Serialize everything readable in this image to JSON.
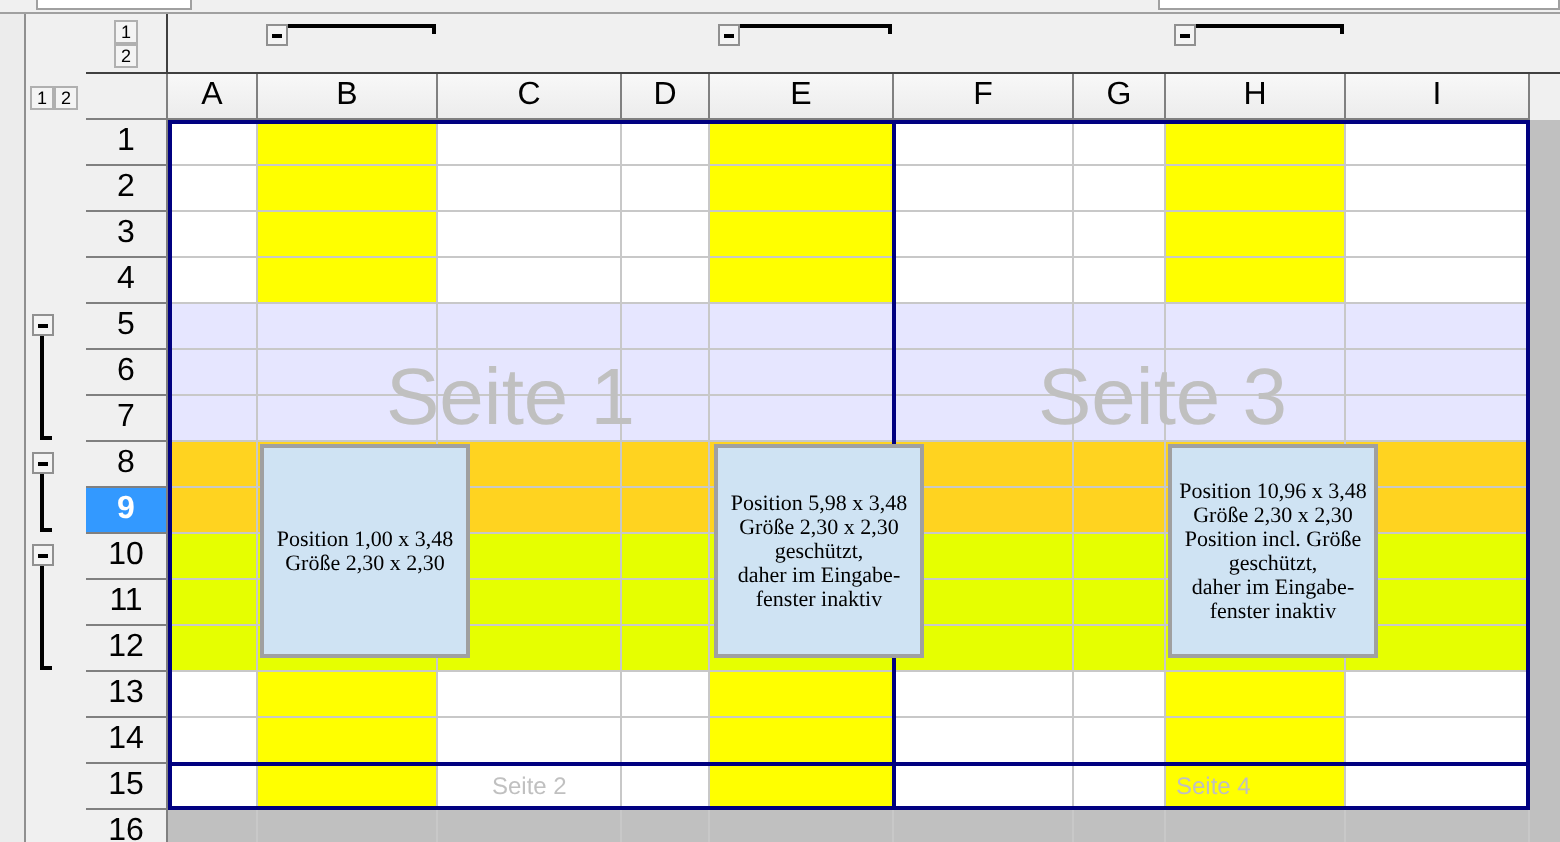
{
  "column_outline_levels": [
    "1",
    "2"
  ],
  "row_outline_levels": [
    "1",
    "2"
  ],
  "columns": [
    {
      "label": "A",
      "selected": false
    },
    {
      "label": "B",
      "selected": false,
      "color": "#ffff00",
      "grouped": true,
      "expanded": true
    },
    {
      "label": "C",
      "selected": false
    },
    {
      "label": "D",
      "selected": false
    },
    {
      "label": "E",
      "selected": false,
      "color": "#ffff00",
      "grouped": true,
      "expanded": true
    },
    {
      "label": "F",
      "selected": false
    },
    {
      "label": "G",
      "selected": false
    },
    {
      "label": "H",
      "selected": false,
      "color": "#ffff00",
      "grouped": true,
      "expanded": true
    },
    {
      "label": "I",
      "selected": false
    }
  ],
  "rows": [
    {
      "label": "1",
      "selected": false
    },
    {
      "label": "2",
      "selected": false
    },
    {
      "label": "3",
      "selected": false
    },
    {
      "label": "4",
      "selected": false
    },
    {
      "label": "5",
      "selected": false,
      "color": "#e6e6ff",
      "group_start": true,
      "expanded": true
    },
    {
      "label": "6",
      "selected": false,
      "color": "#e6e6ff",
      "in_group": true
    },
    {
      "label": "7",
      "selected": false,
      "color": "#e6e6ff",
      "in_group": true
    },
    {
      "label": "8",
      "selected": false,
      "color": "#ffd320",
      "group_start": true,
      "expanded": true
    },
    {
      "label": "9",
      "selected": true,
      "color": "#ffd320",
      "in_group": true
    },
    {
      "label": "10",
      "selected": false,
      "color": "#e6ff00",
      "group_start": true,
      "expanded": true
    },
    {
      "label": "11",
      "selected": false,
      "color": "#e6ff00",
      "in_group": true
    },
    {
      "label": "12",
      "selected": false,
      "color": "#e6ff00",
      "in_group": true
    },
    {
      "label": "13",
      "selected": false
    },
    {
      "label": "14",
      "selected": false
    },
    {
      "label": "15",
      "selected": false
    },
    {
      "label": "16",
      "selected": false,
      "color": "#c0c0c0"
    }
  ],
  "page_labels": [
    {
      "text": "Seite 1",
      "kind": "large"
    },
    {
      "text": "Seite 3",
      "kind": "large"
    },
    {
      "text": "Seite 2",
      "kind": "small"
    },
    {
      "text": "Seite 4",
      "kind": "small"
    }
  ],
  "text_boxes": [
    {
      "text": "Position 1,00 x 3,48\nGröße 2,30 x 2,30"
    },
    {
      "text": "Position 5,98 x 3,48\nGröße 2,30 x 2,30\ngeschützt,\ndaher im Eingabe-\nfenster inaktiv"
    },
    {
      "text": "Position 10,96 x 3,48\nGröße 2,30 x 2,30\nPosition incl. Größe\ngeschützt,\ndaher im Eingabe-\nfenster inaktiv"
    }
  ]
}
